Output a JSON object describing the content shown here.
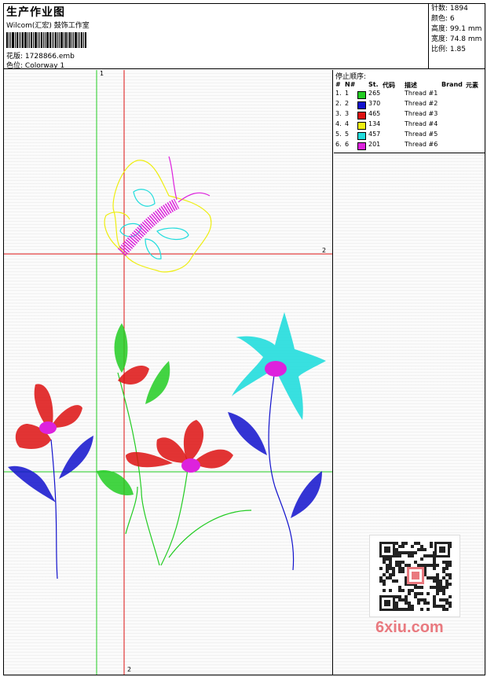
{
  "header": {
    "title": "生产作业图",
    "subtitle": "Wilcom(汇宏) 鼓饰工作室",
    "design_label": "花版:",
    "design_file": "1728866.emb",
    "colorway_label": "色位:",
    "colorway": "Colorway 1"
  },
  "stats": {
    "stitches_label": "针数:",
    "stitches": "1894",
    "colors_label": "颜色:",
    "colors": "6",
    "height_label": "高度:",
    "height": "99.1 mm",
    "width_label": "宽度:",
    "width": "74.8 mm",
    "scale_label": "比例:",
    "scale": "1.85"
  },
  "stop_sequence": {
    "title": "停止顺序:",
    "headers": {
      "num": "#",
      "n": "N#",
      "st": "St.",
      "code": "代码",
      "desc": "描述",
      "brand": "Brand",
      "elem": "元素"
    },
    "rows": [
      {
        "num": "1.",
        "n": "1",
        "code": "265",
        "desc": "Thread #1",
        "color": "#22cc22"
      },
      {
        "num": "2.",
        "n": "2",
        "code": "370",
        "desc": "Thread #2",
        "color": "#1111cc"
      },
      {
        "num": "3.",
        "n": "3",
        "code": "465",
        "desc": "Thread #3",
        "color": "#dd1111"
      },
      {
        "num": "4.",
        "n": "4",
        "code": "134",
        "desc": "Thread #4",
        "color": "#eeee11"
      },
      {
        "num": "5.",
        "n": "5",
        "code": "457",
        "desc": "Thread #5",
        "color": "#22dddd"
      },
      {
        "num": "6.",
        "n": "6",
        "code": "201",
        "desc": "Thread #6",
        "color": "#dd22dd"
      }
    ]
  },
  "markers": {
    "green_top": "1",
    "red_right": "2",
    "red_bottom": "2"
  },
  "watermark": "6xiu.com"
}
